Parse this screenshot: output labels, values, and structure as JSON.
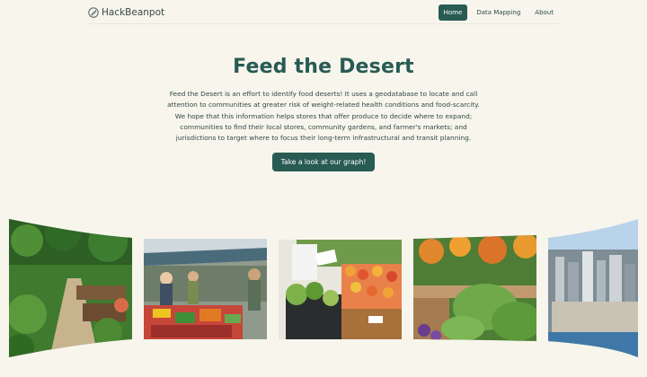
{
  "brand": {
    "name": "HackBeanpot",
    "logo_icon": "hackbeanpot-logo-icon"
  },
  "nav": {
    "items": [
      "Home",
      "Data Mapping",
      "About"
    ],
    "active": "Home"
  },
  "hero": {
    "title": "Feed the Desert",
    "description": "Feed the Desert is an effort to identify food deserts! It uses a geodatabase to locate and call attention to communities at greater risk of weight-related health conditions and food-scarcity. We hope that this information helps stores that offer produce to decide where to expand; communities to find their local stores, community gardens, and farmer's markets; and jurisdictions to target where to focus their long-term infrastructural and transit planning.",
    "cta_label": "Take a look at our graph!"
  },
  "gallery": {
    "images": [
      "community-garden-image",
      "farmers-market-image",
      "grocery-produce-image",
      "raised-garden-bed-image",
      "city-skyline-image"
    ]
  },
  "colors": {
    "accent": "#275b53",
    "background": "#f7f5ec",
    "text": "#2f4a44"
  }
}
